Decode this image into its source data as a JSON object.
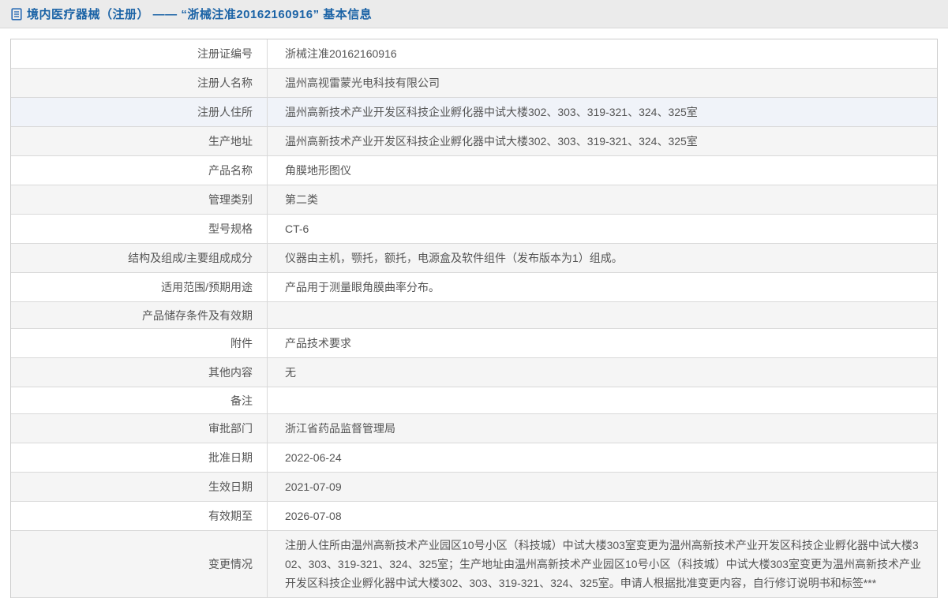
{
  "header": {
    "icon": "document-icon",
    "title": "境内医疗器械（注册） —— “浙械注准20162160916” 基本信息"
  },
  "colors": {
    "title_blue": "#1b63a6",
    "header_bg": "#ebebeb",
    "row_stripe": "#f5f5f5",
    "row_hover": "#f0f3f9",
    "border": "#d9d9d9",
    "text": "#555555"
  },
  "ui_state": {
    "highlighted_row_index": 2
  },
  "table": {
    "rows": [
      {
        "label": "注册证编号",
        "value": "浙械注准20162160916"
      },
      {
        "label": "注册人名称",
        "value": "温州高视雷蒙光电科技有限公司"
      },
      {
        "label": "注册人住所",
        "value": "温州高新技术产业开发区科技企业孵化器中试大楼302、303、319-321、324、325室"
      },
      {
        "label": "生产地址",
        "value": "温州高新技术产业开发区科技企业孵化器中试大楼302、303、319-321、324、325室"
      },
      {
        "label": "产品名称",
        "value": "角膜地形图仪"
      },
      {
        "label": "管理类别",
        "value": "第二类"
      },
      {
        "label": "型号规格",
        "value": "CT-6"
      },
      {
        "label": "结构及组成/主要组成成分",
        "value": "仪器由主机，颚托，额托，电源盒及软件组件（发布版本为1）组成。"
      },
      {
        "label": "适用范围/预期用途",
        "value": "产品用于测量眼角膜曲率分布。"
      },
      {
        "label": "产品储存条件及有效期",
        "value": ""
      },
      {
        "label": "附件",
        "value": "产品技术要求"
      },
      {
        "label": "其他内容",
        "value": "无"
      },
      {
        "label": "备注",
        "value": ""
      },
      {
        "label": "审批部门",
        "value": "浙江省药品监督管理局"
      },
      {
        "label": "批准日期",
        "value": "2022-06-24"
      },
      {
        "label": "生效日期",
        "value": "2021-07-09"
      },
      {
        "label": "有效期至",
        "value": "2026-07-08"
      },
      {
        "label": "变更情况",
        "value": "注册人住所由温州高新技术产业园区10号小区（科技城）中试大楼303室变更为温州高新技术产业开发区科技企业孵化器中试大楼302、303、319-321、324、325室；生产地址由温州高新技术产业园区10号小区（科技城）中试大楼303室变更为温州高新技术产业开发区科技企业孵化器中试大楼302、303、319-321、324、325室。申请人根据批准变更内容，自行修订说明书和标签***"
      }
    ]
  }
}
